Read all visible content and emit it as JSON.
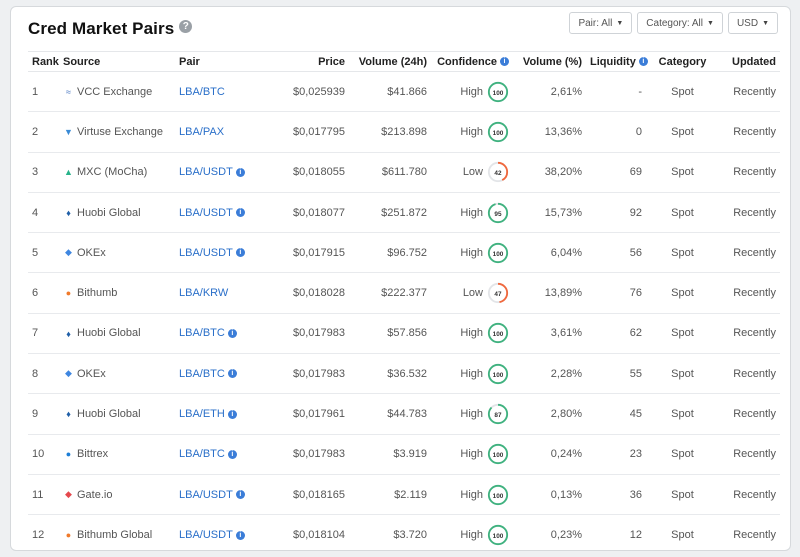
{
  "header": {
    "title": "Cred Market Pairs",
    "help": "?"
  },
  "filters": [
    {
      "label": "Pair: All"
    },
    {
      "label": "Category: All"
    },
    {
      "label": "USD"
    }
  ],
  "columns": {
    "rank": "Rank",
    "source": "Source",
    "pair": "Pair",
    "price": "Price",
    "volume": "Volume (24h)",
    "confidence": "Confidence",
    "volume_pct": "Volume (%)",
    "liquidity": "Liquidity",
    "category": "Category",
    "updated": "Updated"
  },
  "colors": {
    "high": "#3fb27f",
    "low": "#f0683d",
    "ring_bg": "#e3e5e8",
    "link": "#2a6fc9"
  },
  "rows": [
    {
      "rank": "1",
      "source": "VCC Exchange",
      "icon": "vcc-icon",
      "icon_color": "#4a78c2",
      "pair": "LBA/BTC",
      "pair_info": false,
      "price": "$0,025939",
      "volume": "$41.866",
      "confidence": "High",
      "score": "100",
      "volume_pct": "2,61%",
      "liquidity": "-",
      "category": "Spot",
      "updated": "Recently"
    },
    {
      "rank": "2",
      "source": "Virtuse Exchange",
      "icon": "virtuse-icon",
      "icon_color": "#3a8bd6",
      "pair": "LBA/PAX",
      "pair_info": false,
      "price": "$0,017795",
      "volume": "$213.898",
      "confidence": "High",
      "score": "100",
      "volume_pct": "13,36%",
      "liquidity": "0",
      "category": "Spot",
      "updated": "Recently"
    },
    {
      "rank": "3",
      "source": "MXC (MoCha)",
      "icon": "mxc-icon",
      "icon_color": "#27b38a",
      "pair": "LBA/USDT",
      "pair_info": true,
      "price": "$0,018055",
      "volume": "$611.780",
      "confidence": "Low",
      "score": "42",
      "volume_pct": "38,20%",
      "liquidity": "69",
      "category": "Spot",
      "updated": "Recently"
    },
    {
      "rank": "4",
      "source": "Huobi Global",
      "icon": "huobi-icon",
      "icon_color": "#1f5fa8",
      "pair": "LBA/USDT",
      "pair_info": true,
      "price": "$0,018077",
      "volume": "$251.872",
      "confidence": "High",
      "score": "95",
      "volume_pct": "15,73%",
      "liquidity": "92",
      "category": "Spot",
      "updated": "Recently"
    },
    {
      "rank": "5",
      "source": "OKEx",
      "icon": "okex-icon",
      "icon_color": "#3e86e0",
      "pair": "LBA/USDT",
      "pair_info": true,
      "price": "$0,017915",
      "volume": "$96.752",
      "confidence": "High",
      "score": "100",
      "volume_pct": "6,04%",
      "liquidity": "56",
      "category": "Spot",
      "updated": "Recently"
    },
    {
      "rank": "6",
      "source": "Bithumb",
      "icon": "bithumb-icon",
      "icon_color": "#f07a2a",
      "pair": "LBA/KRW",
      "pair_info": false,
      "price": "$0,018028",
      "volume": "$222.377",
      "confidence": "Low",
      "score": "47",
      "volume_pct": "13,89%",
      "liquidity": "76",
      "category": "Spot",
      "updated": "Recently"
    },
    {
      "rank": "7",
      "source": "Huobi Global",
      "icon": "huobi-icon",
      "icon_color": "#1f5fa8",
      "pair": "LBA/BTC",
      "pair_info": true,
      "price": "$0,017983",
      "volume": "$57.856",
      "confidence": "High",
      "score": "100",
      "volume_pct": "3,61%",
      "liquidity": "62",
      "category": "Spot",
      "updated": "Recently"
    },
    {
      "rank": "8",
      "source": "OKEx",
      "icon": "okex-icon",
      "icon_color": "#3e86e0",
      "pair": "LBA/BTC",
      "pair_info": true,
      "price": "$0,017983",
      "volume": "$36.532",
      "confidence": "High",
      "score": "100",
      "volume_pct": "2,28%",
      "liquidity": "55",
      "category": "Spot",
      "updated": "Recently"
    },
    {
      "rank": "9",
      "source": "Huobi Global",
      "icon": "huobi-icon",
      "icon_color": "#1f5fa8",
      "pair": "LBA/ETH",
      "pair_info": true,
      "price": "$0,017961",
      "volume": "$44.783",
      "confidence": "High",
      "score": "87",
      "volume_pct": "2,80%",
      "liquidity": "45",
      "category": "Spot",
      "updated": "Recently"
    },
    {
      "rank": "10",
      "source": "Bittrex",
      "icon": "bittrex-icon",
      "icon_color": "#1c7ed6",
      "pair": "LBA/BTC",
      "pair_info": true,
      "price": "$0,017983",
      "volume": "$3.919",
      "confidence": "High",
      "score": "100",
      "volume_pct": "0,24%",
      "liquidity": "23",
      "category": "Spot",
      "updated": "Recently"
    },
    {
      "rank": "11",
      "source": "Gate.io",
      "icon": "gateio-icon",
      "icon_color": "#e5484d",
      "pair": "LBA/USDT",
      "pair_info": true,
      "price": "$0,018165",
      "volume": "$2.119",
      "confidence": "High",
      "score": "100",
      "volume_pct": "0,13%",
      "liquidity": "36",
      "category": "Spot",
      "updated": "Recently"
    },
    {
      "rank": "12",
      "source": "Bithumb Global",
      "icon": "bithumb-global-icon",
      "icon_color": "#f07a2a",
      "pair": "LBA/USDT",
      "pair_info": true,
      "price": "$0,018104",
      "volume": "$3.720",
      "confidence": "High",
      "score": "100",
      "volume_pct": "0,23%",
      "liquidity": "12",
      "category": "Spot",
      "updated": "Recently"
    }
  ]
}
